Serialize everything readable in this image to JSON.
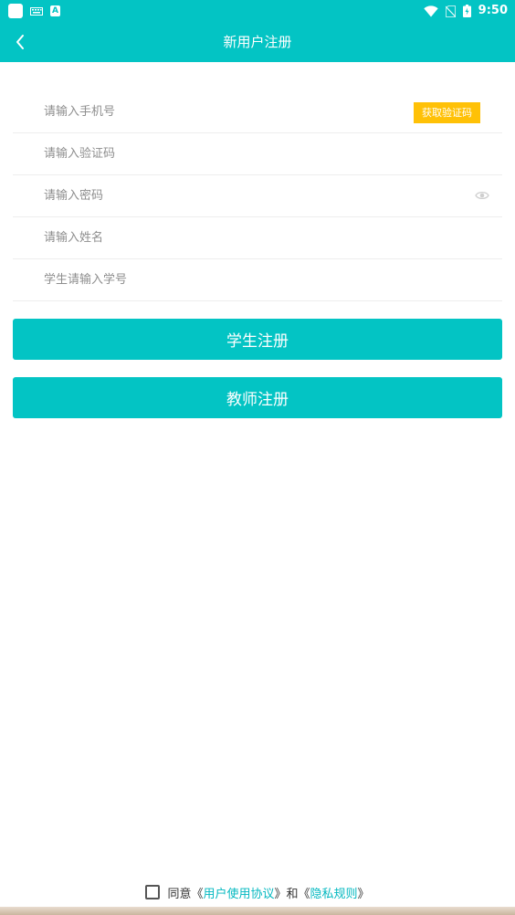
{
  "status_bar": {
    "time": "9:50",
    "left_icons": [
      "app-icon",
      "keyboard-icon",
      "a-badge-icon"
    ],
    "right_icons": [
      "wifi-icon",
      "no-sim-icon",
      "battery-charging-icon"
    ]
  },
  "header": {
    "title": "新用户注册",
    "back_icon": "chevron-left-icon"
  },
  "form": {
    "phone_placeholder": "请输入手机号",
    "get_code_label": "获取验证码",
    "code_placeholder": "请输入验证码",
    "password_placeholder": "请输入密码",
    "password_toggle_icon": "eye-icon",
    "name_placeholder": "请输入姓名",
    "student_id_placeholder": "学生请输入学号"
  },
  "actions": {
    "student_register": "学生注册",
    "teacher_register": "教师注册"
  },
  "agreement": {
    "prefix": "同意《",
    "user_agreement": "用户使用协议",
    "middle": "》和《",
    "privacy_rules": "隐私规则",
    "suffix": "》",
    "checked": false
  },
  "colors": {
    "primary": "#03c4c4",
    "code_button": "#ffc107",
    "link": "#03b8c0"
  }
}
